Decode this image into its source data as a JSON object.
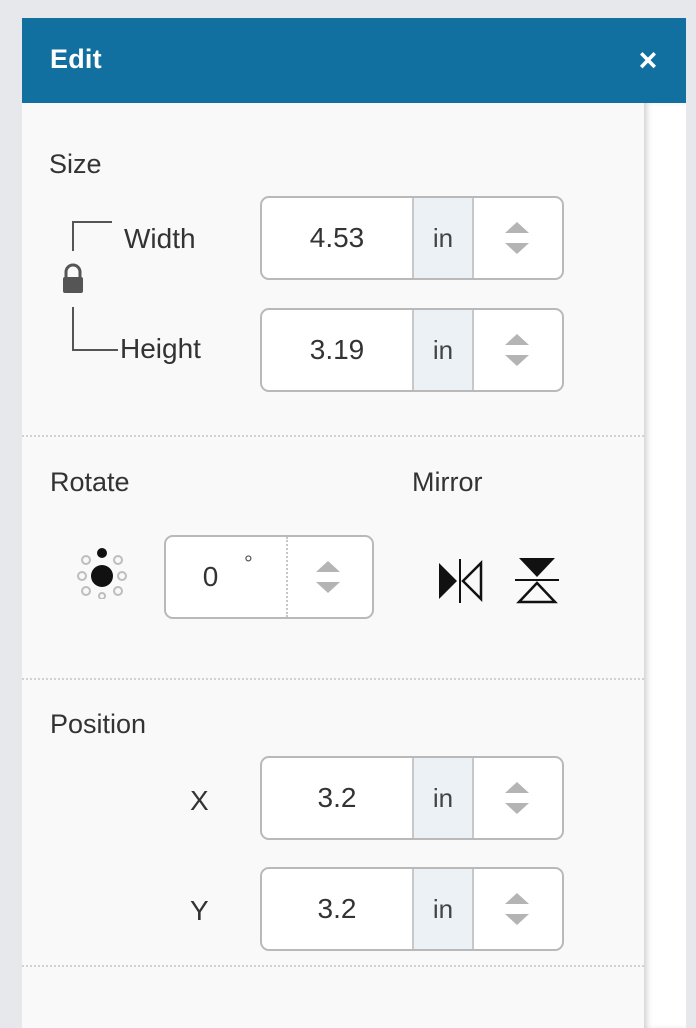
{
  "header": {
    "title": "Edit",
    "close_glyph": "×"
  },
  "size": {
    "title": "Size",
    "width": {
      "label": "Width",
      "value": "4.53",
      "unit": "in"
    },
    "height": {
      "label": "Height",
      "value": "3.19",
      "unit": "in"
    },
    "lock_icon": "lock-icon"
  },
  "rotate": {
    "title": "Rotate",
    "value": "0",
    "unit": "°",
    "icon": "rotate-dial-icon"
  },
  "mirror": {
    "title": "Mirror",
    "horizontal_icon": "mirror-horizontal-icon",
    "vertical_icon": "mirror-vertical-icon"
  },
  "position": {
    "title": "Position",
    "x": {
      "label": "X",
      "value": "3.2",
      "unit": "in"
    },
    "y": {
      "label": "Y",
      "value": "3.2",
      "unit": "in"
    }
  },
  "colors": {
    "header": "#11709f",
    "field_border": "#b9b9b9",
    "unit_bg": "#ecf1f6"
  }
}
